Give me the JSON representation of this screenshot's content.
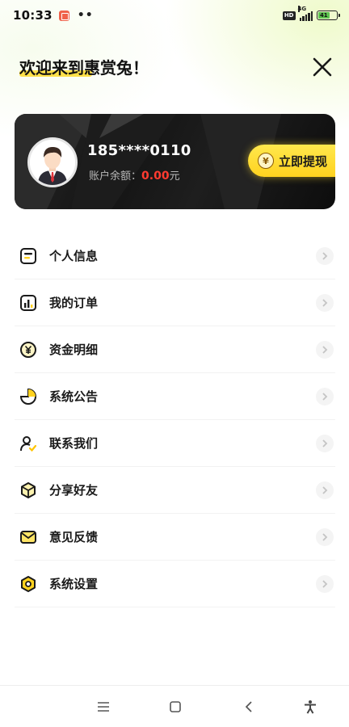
{
  "status_bar": {
    "time": "10:33",
    "dots": "••",
    "hd": "HD",
    "network": "4G",
    "battery": "41"
  },
  "header": {
    "welcome": "欢迎来到惠赏兔！"
  },
  "account_card": {
    "phone": "185****0110",
    "balance_label": "账户余额：",
    "balance_amount": "0.00",
    "balance_unit": "元",
    "withdraw_label": "立即提现",
    "coin_symbol": "¥"
  },
  "menu": {
    "items": [
      {
        "label": "个人信息",
        "icon": "profile-card-icon"
      },
      {
        "label": "我的订单",
        "icon": "bar-chart-icon"
      },
      {
        "label": "资金明细",
        "icon": "yuan-coin-icon"
      },
      {
        "label": "系统公告",
        "icon": "pie-chart-icon"
      },
      {
        "label": "联系我们",
        "icon": "user-check-icon"
      },
      {
        "label": "分享好友",
        "icon": "cube-icon"
      },
      {
        "label": "意见反馈",
        "icon": "mail-icon"
      },
      {
        "label": "系统设置",
        "icon": "settings-hexagon-icon"
      }
    ]
  },
  "colors": {
    "accent_yellow": "#ffd21f",
    "amount_red": "#ff3b30",
    "card_dark": "#141414"
  }
}
